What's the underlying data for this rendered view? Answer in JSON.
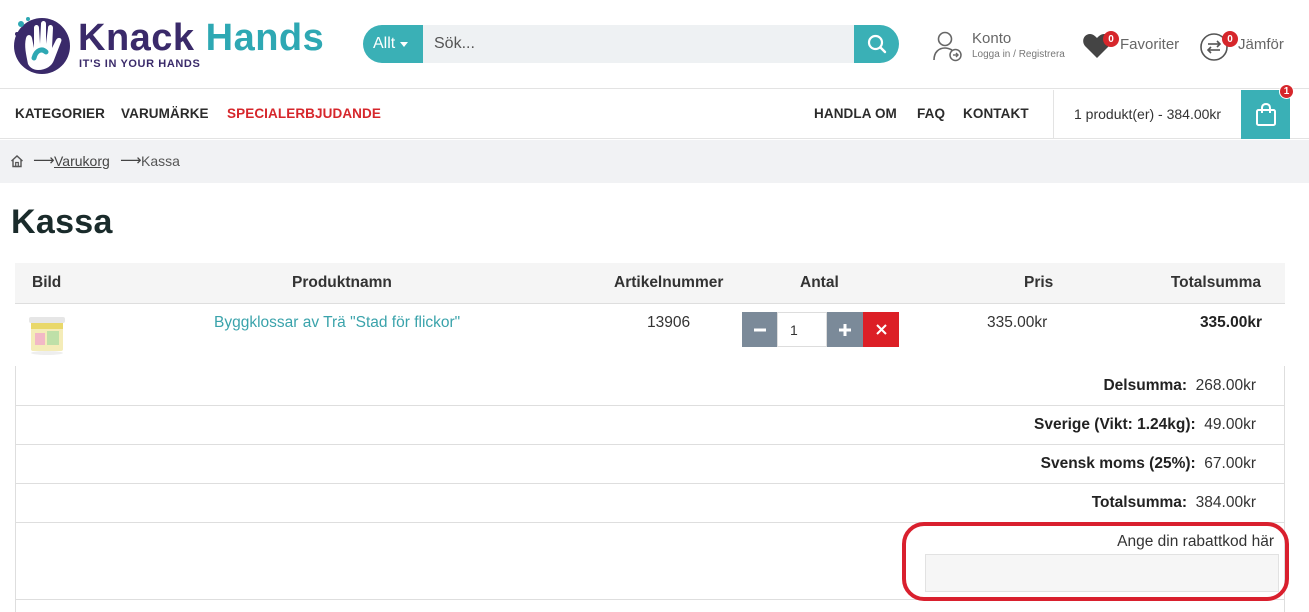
{
  "brand": {
    "name_part1": "Knack",
    "name_part2": "Hands",
    "tagline": "IT'S IN YOUR HANDS"
  },
  "search": {
    "category": "Allt",
    "placeholder": "Sök...",
    "icon": "search-icon"
  },
  "account": {
    "title": "Konto",
    "subtitle": "Logga in / Registrera",
    "icon": "user-icon"
  },
  "favorites": {
    "label": "Favoriter",
    "count": "0",
    "icon": "heart-icon"
  },
  "compare": {
    "label": "Jämför",
    "count": "0",
    "icon": "compare-arrows-icon"
  },
  "nav": {
    "left": [
      "KATEGORIER",
      "VARUMÄRKE",
      "SPECIALERBJUDANDE"
    ],
    "right": [
      "HANDLA OM",
      "FAQ",
      "KONTAKT"
    ],
    "cart_summary": "1 produkt(er) - 384.00kr",
    "cart_count": "1"
  },
  "breadcrumb": {
    "items": [
      "Varukorg",
      "Kassa"
    ]
  },
  "page_title": "Kassa",
  "table": {
    "headers": [
      "Bild",
      "Produktnamn",
      "Artikelnummer",
      "Antal",
      "Pris",
      "Totalsumma"
    ],
    "rows": [
      {
        "name": "Byggklossar av Trä \"Stad för flickor\"",
        "sku": "13906",
        "quantity": "1",
        "price": "335.00kr",
        "total": "335.00kr"
      }
    ]
  },
  "summary": {
    "subtotal_label": "Delsumma:",
    "subtotal": "268.00kr",
    "shipping_label": "Sverige (Vikt: 1.24kg):",
    "shipping": "49.00kr",
    "tax_label": "Svensk moms (25%):",
    "tax": "67.00kr",
    "total_label": "Totalsumma:",
    "total": "384.00kr"
  },
  "coupon": {
    "label": "Ange din rabattkod här",
    "value": ""
  },
  "colors": {
    "accent": "#3ab0b6",
    "brand_dark": "#3a2a6a",
    "danger": "#dc1f26",
    "highlight": "#d9202e"
  }
}
